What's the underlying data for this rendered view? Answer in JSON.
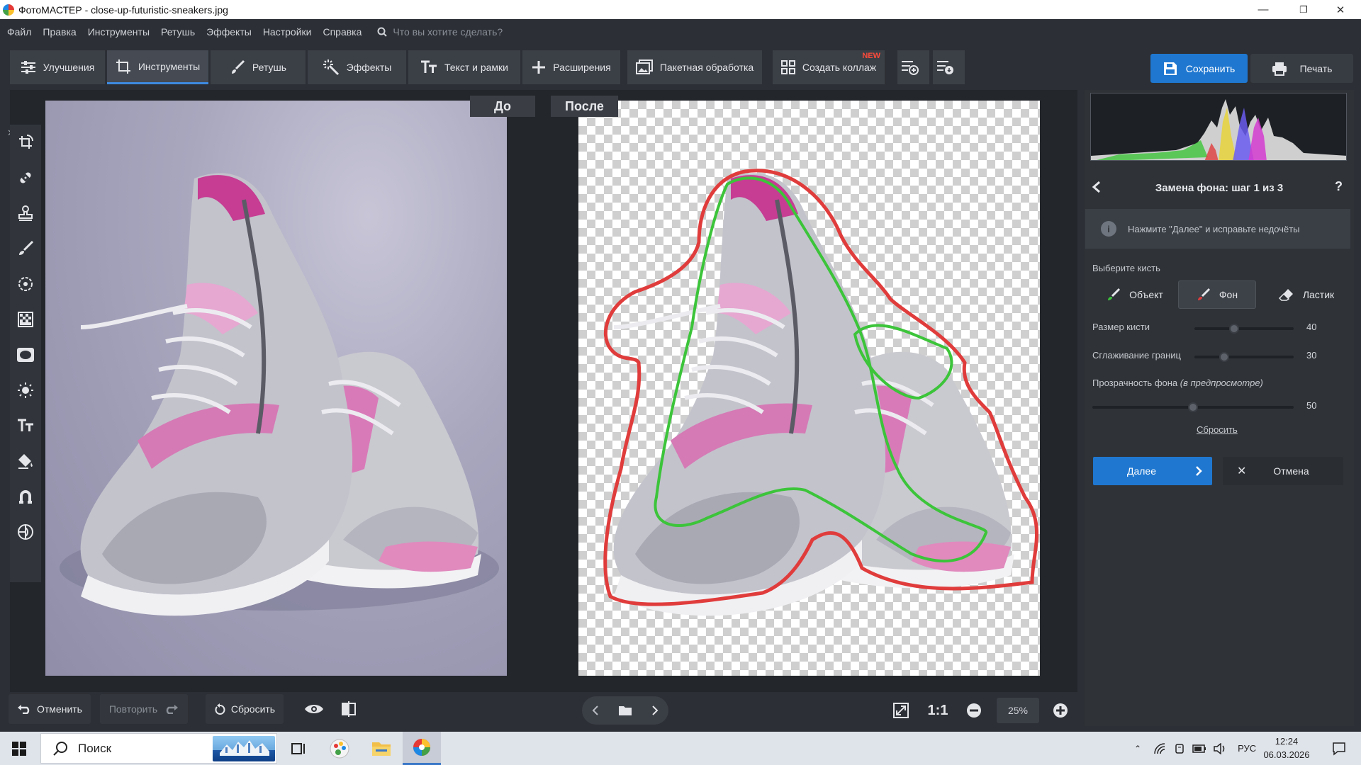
{
  "window": {
    "title": "ФотоМАСТЕР - close-up-futuristic-sneakers.jpg",
    "controls": [
      "—",
      "❐",
      "✕"
    ]
  },
  "menu": {
    "items": [
      "Файл",
      "Правка",
      "Инструменты",
      "Ретушь",
      "Эффекты",
      "Настройки",
      "Справка"
    ],
    "search_placeholder": "Что вы хотите сделать?"
  },
  "toolbar": {
    "tabs": [
      {
        "label": "Улучшения",
        "icon": "sliders-icon",
        "active": false
      },
      {
        "label": "Инструменты",
        "icon": "crop-icon",
        "active": true
      },
      {
        "label": "Ретушь",
        "icon": "brush-icon",
        "active": false
      },
      {
        "label": "Эффекты",
        "icon": "magic-wand-icon",
        "active": false
      },
      {
        "label": "Текст и рамки",
        "icon": "text-icon",
        "active": false
      },
      {
        "label": "Расширения",
        "icon": "plus-icon",
        "active": false
      },
      {
        "label": "Пакетная обработка",
        "icon": "batch-icon",
        "active": false
      },
      {
        "label": "Создать коллаж",
        "icon": "collage-icon",
        "active": false,
        "badge": "NEW"
      }
    ],
    "save_label": "Сохранить",
    "print_label": "Печать"
  },
  "canvas": {
    "before_label": "До",
    "after_label": "После"
  },
  "panel": {
    "title": "Замена фона: шаг 1 из 3",
    "help": "?",
    "info": "Нажмите \"Далее\" и исправьте недочёты",
    "brush_heading": "Выберите кисть",
    "brushes": [
      {
        "label": "Объект",
        "active": false
      },
      {
        "label": "Фон",
        "active": true
      },
      {
        "label": "Ластик",
        "active": false
      }
    ],
    "brush_size_label": "Размер кисти",
    "brush_size_value": 40,
    "brush_size_fraction": 0.4,
    "smoothing_label": "Сглаживание границ",
    "smoothing_value": 30,
    "smoothing_fraction": 0.3,
    "transparency_label": "Прозрачность фона",
    "transparency_note": "(в предпросмотре)",
    "transparency_value": 50,
    "transparency_fraction": 0.5,
    "reset_link": "Сбросить",
    "next_label": "Далее",
    "cancel_label": "Отмена"
  },
  "bottom": {
    "undo_label": "Отменить",
    "redo_label": "Повторить",
    "reset_label": "Сбросить",
    "ratio_label": "1:1",
    "zoom_value": "25%"
  },
  "taskbar": {
    "search_label": "Поиск",
    "lang": "РУС",
    "time": "12:24",
    "date": "06.03.2026"
  },
  "colors": {
    "accent": "#1f77d0",
    "object_brush": "#3cc43a",
    "background_brush": "#e03c3c",
    "new_badge": "#ff4b3a"
  }
}
